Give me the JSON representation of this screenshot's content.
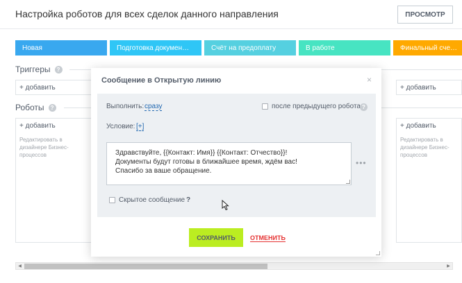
{
  "header": {
    "title": "Настройка роботов для всех сделок данного направления",
    "preview_label": "ПРОСМОТР"
  },
  "stages": [
    {
      "label": "Новая",
      "color": "#39a8ef"
    },
    {
      "label": "Подготовка докумен…",
      "color": "#2fc6f6"
    },
    {
      "label": "Счёт на предоплату",
      "color": "#55d0e0"
    },
    {
      "label": "В работе",
      "color": "#47e4c2"
    },
    {
      "label": "Финальный сче…",
      "color": "#ffa900"
    }
  ],
  "triggers": {
    "label": "Триггеры",
    "add_label": "+ добавить",
    "add_label_right": "+ добавить"
  },
  "robots": {
    "label": "Роботы",
    "add_label": "+ добавить",
    "add_label_right": "+ добавить",
    "designer_note": "Редактировать в дизайнере Бизнес-процессов",
    "designer_note_right": "Редактировать в дизайнере Бизнес-процессов"
  },
  "modal": {
    "title": "Сообщение в Открытую линию",
    "close_glyph": "×",
    "execute_label": "Выполнить:",
    "execute_value": "сразу",
    "after_previous_label": "после предыдущего робота",
    "condition_label": "Условие:",
    "condition_value": "[+]",
    "message_lines": [
      "Здравствуйте, {{Контакт: Имя}} {{Контакт: Отчество}}!",
      "Документы будут готовы в ближайшее время, ждём вас!",
      "Спасибо за ваше обращение."
    ],
    "more_glyph": "•••",
    "hidden_message_label": "Скрытое сообщение",
    "hidden_help": "?",
    "save_label": "СОХРАНИТЬ",
    "cancel_label": "ОТМЕНИТЬ"
  }
}
